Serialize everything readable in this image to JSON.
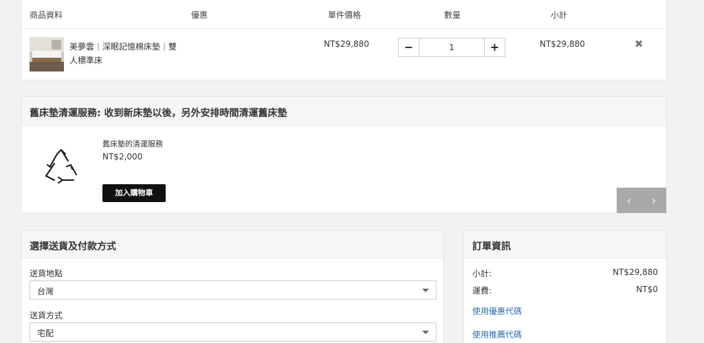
{
  "cart": {
    "headers": {
      "product": "商品資料",
      "discount": "優惠",
      "unit_price": "單件價格",
      "quantity": "數量",
      "subtotal": "小計"
    },
    "item": {
      "name": "美夢雲｜深眠記憶棉床墊｜雙人標準床",
      "unit_price": "NT$29,880",
      "quantity": "1",
      "subtotal": "NT$29,880"
    }
  },
  "addon": {
    "title": "舊床墊清運服務: 收到新床墊以後，另外安排時間清運舊床墊",
    "item_name": "舊床墊的清運服務",
    "item_price": "NT$2,000",
    "add_button": "加入購物車"
  },
  "shipping": {
    "title": "選擇送貨及付款方式",
    "location_label": "送貨地點",
    "location_value": "台灣",
    "method_label": "送貨方式",
    "method_value": "宅配"
  },
  "order": {
    "title": "訂單資訊",
    "subtotal_label": "小計:",
    "subtotal_value": "NT$29,880",
    "shipping_label": "運費:",
    "shipping_value": "NT$0",
    "coupon_link": "使用優惠代碼",
    "referral_link": "使用推薦代碼"
  },
  "icons": {
    "minus": "minus-icon",
    "plus": "plus-icon",
    "remove": "close-icon",
    "recycle": "recycle-icon",
    "prev": "chevron-left-icon",
    "next": "chevron-right-icon",
    "caret": "caret-down-icon"
  },
  "colors": {
    "add_button_bg": "#111111",
    "link": "#2b6cb0",
    "carousel_nav": "#a9a9a9"
  }
}
